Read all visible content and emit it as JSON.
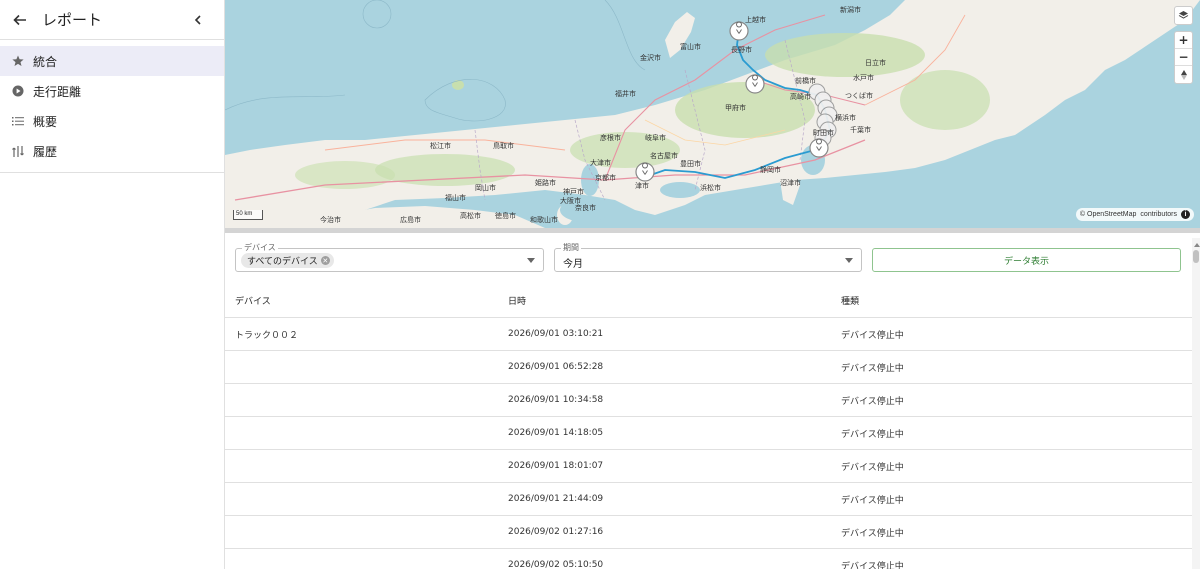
{
  "sidebar": {
    "title": "レポート",
    "back_icon": "arrow-left-icon",
    "collapse_icon": "chevron-left-icon",
    "items": [
      {
        "label": "統合",
        "icon": "star-icon",
        "active": true
      },
      {
        "label": "走行距離",
        "icon": "play-circle-icon",
        "active": false
      },
      {
        "label": "概要",
        "icon": "list-icon",
        "active": false
      },
      {
        "label": "履歴",
        "icon": "route-icon",
        "active": false
      }
    ]
  },
  "map": {
    "attribution_prefix": "© OpenStreetMap",
    "attribution_suffix": "contributors",
    "scale_label": "50 km",
    "controls": {
      "layers": "layers-icon",
      "zoom_in": "+",
      "zoom_out": "−",
      "compass": "compass-icon"
    },
    "labels": [
      "長野市",
      "金沢市",
      "富山市",
      "福井市",
      "前橋市",
      "高崎市",
      "つくば市",
      "千葉市",
      "横浜市",
      "町田市",
      "静岡市",
      "名古屋市",
      "豊田市",
      "浜松市",
      "京都市",
      "大阪市",
      "津市",
      "奈良市",
      "和歌山市",
      "岡山市",
      "広島市",
      "松江市",
      "鳥取市",
      "姫路市",
      "神戸市",
      "福山市",
      "新潟市",
      "上越市",
      "日立市",
      "水戸市",
      "沼津市",
      "甲府市",
      "彦根市",
      "岐阜市",
      "大津市",
      "徳島市",
      "高松市",
      "今治市"
    ],
    "colors": {
      "water": "#aad3df",
      "land": "#f2efe9",
      "forest": "#c8dfae",
      "route": "#2a9bd1"
    }
  },
  "filters": {
    "device_label": "デバイス",
    "device_chip": "すべてのデバイス",
    "period_label": "期間",
    "period_value": "今月",
    "show_button": "データ表示"
  },
  "table": {
    "headers": [
      "デバイス",
      "日時",
      "種類"
    ],
    "rows": [
      {
        "device": "トラック００２",
        "datetime": "2026/09/01 03:10:21",
        "type": "デバイス停止中"
      },
      {
        "device": "",
        "datetime": "2026/09/01 06:52:28",
        "type": "デバイス停止中"
      },
      {
        "device": "",
        "datetime": "2026/09/01 10:34:58",
        "type": "デバイス停止中"
      },
      {
        "device": "",
        "datetime": "2026/09/01 14:18:05",
        "type": "デバイス停止中"
      },
      {
        "device": "",
        "datetime": "2026/09/01 18:01:07",
        "type": "デバイス停止中"
      },
      {
        "device": "",
        "datetime": "2026/09/01 21:44:09",
        "type": "デバイス停止中"
      },
      {
        "device": "",
        "datetime": "2026/09/02 01:27:16",
        "type": "デバイス停止中"
      },
      {
        "device": "",
        "datetime": "2026/09/02 05:10:50",
        "type": "デバイス停止中"
      }
    ]
  }
}
